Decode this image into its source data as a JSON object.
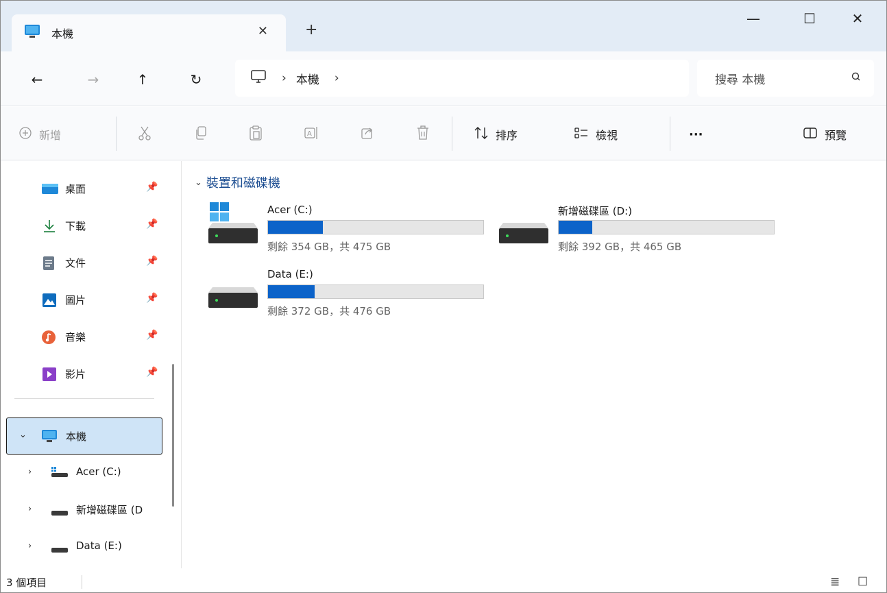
{
  "tab": {
    "title": "本機",
    "icon": "monitor-icon"
  },
  "window_controls": {
    "minimize": "—",
    "maximize": "☐",
    "close": "✕"
  },
  "nav": {
    "back": "←",
    "forward": "→",
    "up": "↑",
    "refresh": "↻"
  },
  "address": {
    "crumbs": [
      "本機"
    ],
    "separator": "›"
  },
  "search": {
    "placeholder": "搜尋 本機"
  },
  "commands": {
    "new_label": "新增",
    "sort_label": "排序",
    "view_label": "檢視",
    "more_label": "···",
    "preview_label": "預覽"
  },
  "sidebar": {
    "quick": [
      {
        "label": "桌面",
        "icon": "desktop-icon"
      },
      {
        "label": "下載",
        "icon": "download-icon"
      },
      {
        "label": "文件",
        "icon": "documents-icon"
      },
      {
        "label": "圖片",
        "icon": "pictures-icon"
      },
      {
        "label": "音樂",
        "icon": "music-icon"
      },
      {
        "label": "影片",
        "icon": "videos-icon"
      }
    ],
    "this_pc": "本機",
    "drives": [
      "Acer (C:)",
      "新增磁碟區 (D",
      "Data (E:)"
    ]
  },
  "content": {
    "group_title": "裝置和磁碟機",
    "drives": [
      {
        "name": "Acer (C:)",
        "free": "剩餘 354 GB，共 475 GB",
        "used_fraction": 0.255
      },
      {
        "name": "新增磁碟區 (D:)",
        "free": "剩餘 392 GB，共 465 GB",
        "used_fraction": 0.157
      },
      {
        "name": "Data (E:)",
        "free": "剩餘 372 GB，共 476 GB",
        "used_fraction": 0.218
      }
    ]
  },
  "status": {
    "item_count": "3 個項目"
  },
  "colors": {
    "accent": "#0c63c9",
    "selection": "#cfe4f7",
    "titlebar": "#e3ecf6",
    "group_heading": "#1d4e92"
  }
}
